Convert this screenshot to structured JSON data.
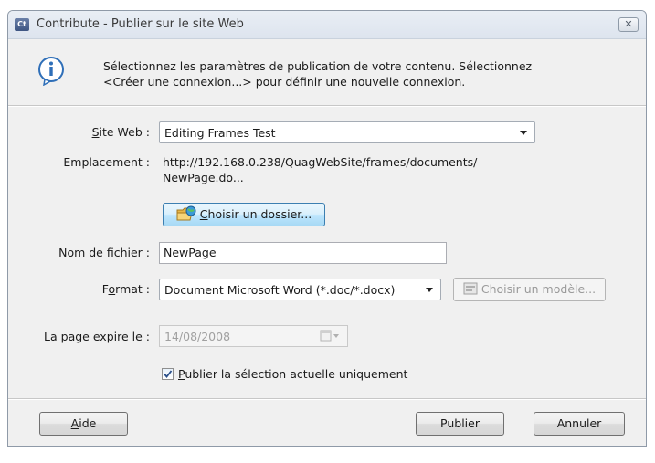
{
  "window": {
    "title": "Contribute - Publier sur le site Web",
    "app_icon": "Ct",
    "close_glyph": "✕"
  },
  "intro": {
    "icon": "info-icon",
    "line1": "Sélectionnez les paramètres de publication de votre contenu. Sélectionnez",
    "line2": "<Créer une connexion...> pour définir une nouvelle connexion."
  },
  "site": {
    "label_mnemonic": "S",
    "label_rest": "ite Web :",
    "selected": "Editing Frames Test"
  },
  "location": {
    "label": "Emplacement :",
    "line1": "http://192.168.0.238/QuagWebSite/frames/documents/",
    "line2": "NewPage.do..."
  },
  "choose_folder": {
    "icon": "folder-globe-icon",
    "mnemonic": "C",
    "rest": "hoisir un dossier..."
  },
  "filename": {
    "label_mnemonic": "N",
    "label_rest": "om de fichier :",
    "value": "NewPage"
  },
  "format": {
    "label_pre": "F",
    "label_mnemonic": "o",
    "label_rest": "rmat :",
    "selected": "Document Microsoft Word (*.doc/*.docx)"
  },
  "choose_template": {
    "icon": "template-icon",
    "label": "Choisir un modèle..."
  },
  "expiry": {
    "label": "La page expire le :",
    "date": "14/08/2008",
    "icon": "calendar-icon"
  },
  "publish_selection": {
    "checked": true,
    "mnemonic": "P",
    "rest": "ublier la sélection actuelle uniquement"
  },
  "footer": {
    "help_mnemonic": "A",
    "help_rest": "ide",
    "publish": "Publier",
    "cancel": "Annuler"
  },
  "colors": {
    "dialog_bg": "#f0f0f0",
    "titlebar": "#e4e9f0",
    "focus_button_border": "#3c7fb1",
    "info_blue": "#2f6fb8"
  }
}
